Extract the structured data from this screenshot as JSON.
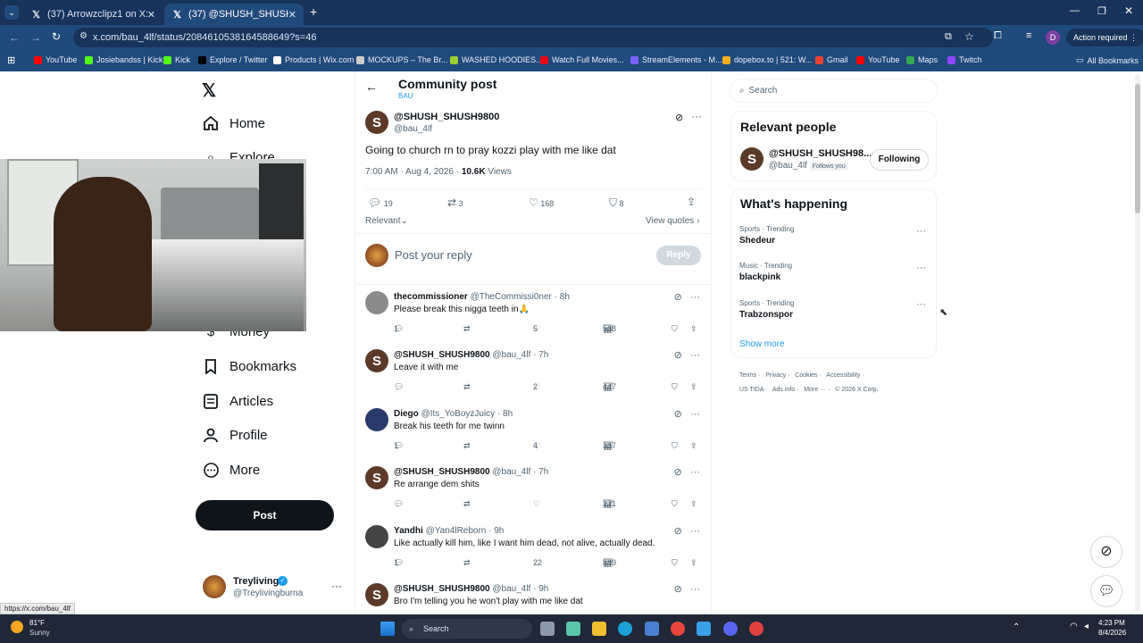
{
  "browser": {
    "tabs": [
      {
        "title": "(37) Arrowzclipz1 on X: \"No wa..."
      },
      {
        "title": "(37) @SHUSH_SHUSH9800 on X..."
      }
    ],
    "url": "x.com/bau_4lf/status/2084610538164588649?s=46",
    "profile_initial": "D",
    "action_required": "Action required",
    "bookmarks": [
      {
        "label": "YouTube",
        "color": "#ff0000"
      },
      {
        "label": "Josiebandss | Kick",
        "color": "#53fc18"
      },
      {
        "label": "Kick",
        "color": "#53fc18"
      },
      {
        "label": "Explore / Twitter",
        "color": "#000000"
      },
      {
        "label": "Products | Wix.com",
        "color": "#ffffff"
      },
      {
        "label": "MOCKUPS – The Br...",
        "color": "#cccccc"
      },
      {
        "label": "WASHED HOODIES...",
        "color": "#9acd32"
      },
      {
        "label": "Watch Full Movies...",
        "color": "#e50914"
      },
      {
        "label": "StreamElements - M...",
        "color": "#7b61ff"
      },
      {
        "label": "dopebox.to | 521: W...",
        "color": "#f2b01e"
      },
      {
        "label": "Gmail",
        "color": "#ea4335"
      },
      {
        "label": "YouTube",
        "color": "#ff0000"
      },
      {
        "label": "Maps",
        "color": "#34a853"
      },
      {
        "label": "Twitch",
        "color": "#9146ff"
      }
    ],
    "all_bookmarks": "All Bookmarks",
    "status_url": "https://x.com/bau_4lf"
  },
  "sidebar": {
    "items": [
      {
        "label": "Home",
        "icon": "home-icon"
      },
      {
        "label": "Explore",
        "icon": "search-icon"
      },
      {
        "label": "Money",
        "icon": "money-icon"
      },
      {
        "label": "Bookmarks",
        "icon": "bookmark-icon"
      },
      {
        "label": "Articles",
        "icon": "article-icon"
      },
      {
        "label": "Profile",
        "icon": "person-icon"
      },
      {
        "label": "More",
        "icon": "more-circle-icon"
      }
    ],
    "post_button": "Post",
    "account": {
      "name": "Treyliving",
      "handle": "@Treylivingburna"
    }
  },
  "header": {
    "title": "Community post",
    "community": "BAU"
  },
  "post": {
    "name": "@SHUSH_SHUSH9800",
    "handle": "@bau_4lf",
    "text": "Going to church rn to pray kozzi play with me like dat",
    "time": "7:00 AM · Aug 4, 2026 · ",
    "views": "10.6K",
    "views_label": " Views",
    "replies": "19",
    "reposts": "3",
    "likes": "168",
    "bookmarks": "8",
    "sort": "Relevant",
    "view_quotes": "View quotes",
    "reply_placeholder": "Post your reply",
    "reply_button": "Reply"
  },
  "replies": [
    {
      "name": "thecommissioner",
      "handle": "@TheCommissi0ner · 8h",
      "text": "Please break this nigga teeth in🙏",
      "r": "1",
      "rt": "",
      "l": "5",
      "v": "568"
    },
    {
      "name": "@SHUSH_SHUSH9800",
      "handle": "@bau_4lf · 7h",
      "text": "Leave it with me",
      "r": "",
      "rt": "",
      "l": "2",
      "v": "447"
    },
    {
      "name": "Diego",
      "handle": "@Its_YoBoyzJuicy · 8h",
      "text": "Break his teeth for me twinn",
      "r": "1",
      "rt": "",
      "l": "4",
      "v": "357"
    },
    {
      "name": "@SHUSH_SHUSH9800",
      "handle": "@bau_4lf · 7h",
      "text": "Re arrange dem shits",
      "r": "",
      "rt": "",
      "l": "",
      "v": "271"
    },
    {
      "name": "Yandhi",
      "handle": "@Yan4lReborn · 9h",
      "text": "Like actually kill him, like I want him dead, not alive, actually dead.",
      "r": "1",
      "rt": "",
      "l": "22",
      "v": "889"
    },
    {
      "name": "@SHUSH_SHUSH9800",
      "handle": "@bau_4lf · 9h",
      "text": "Bro I'm telling you he won't play with me like dat",
      "r": "",
      "rt": "",
      "l": "",
      "v": ""
    }
  ],
  "right": {
    "search_placeholder": "Search",
    "relevant_title": "Relevant people",
    "person": {
      "name": "@SHUSH_SHUSH98...",
      "handle": "@bau_4lf",
      "follows": "Follows you",
      "button": "Following"
    },
    "happening_title": "What's happening",
    "trends": [
      {
        "cat": "Sports · Trending",
        "name": "Shedeur"
      },
      {
        "cat": "Music · Trending",
        "name": "blackpink"
      },
      {
        "cat": "Sports · Trending",
        "name": "Trabzonspor"
      }
    ],
    "show_more": "Show more",
    "footer1": [
      "Terms",
      "Privacy",
      "Cookies",
      "Accessibility"
    ],
    "footer2": [
      "US TIDA",
      "Ads info",
      "More ···",
      "© 2026 X Corp."
    ]
  },
  "taskbar": {
    "weather_temp": "81°F",
    "weather_desc": "Sunny",
    "search": "Search",
    "time": "4:23 PM",
    "date": "8/4/2026"
  }
}
